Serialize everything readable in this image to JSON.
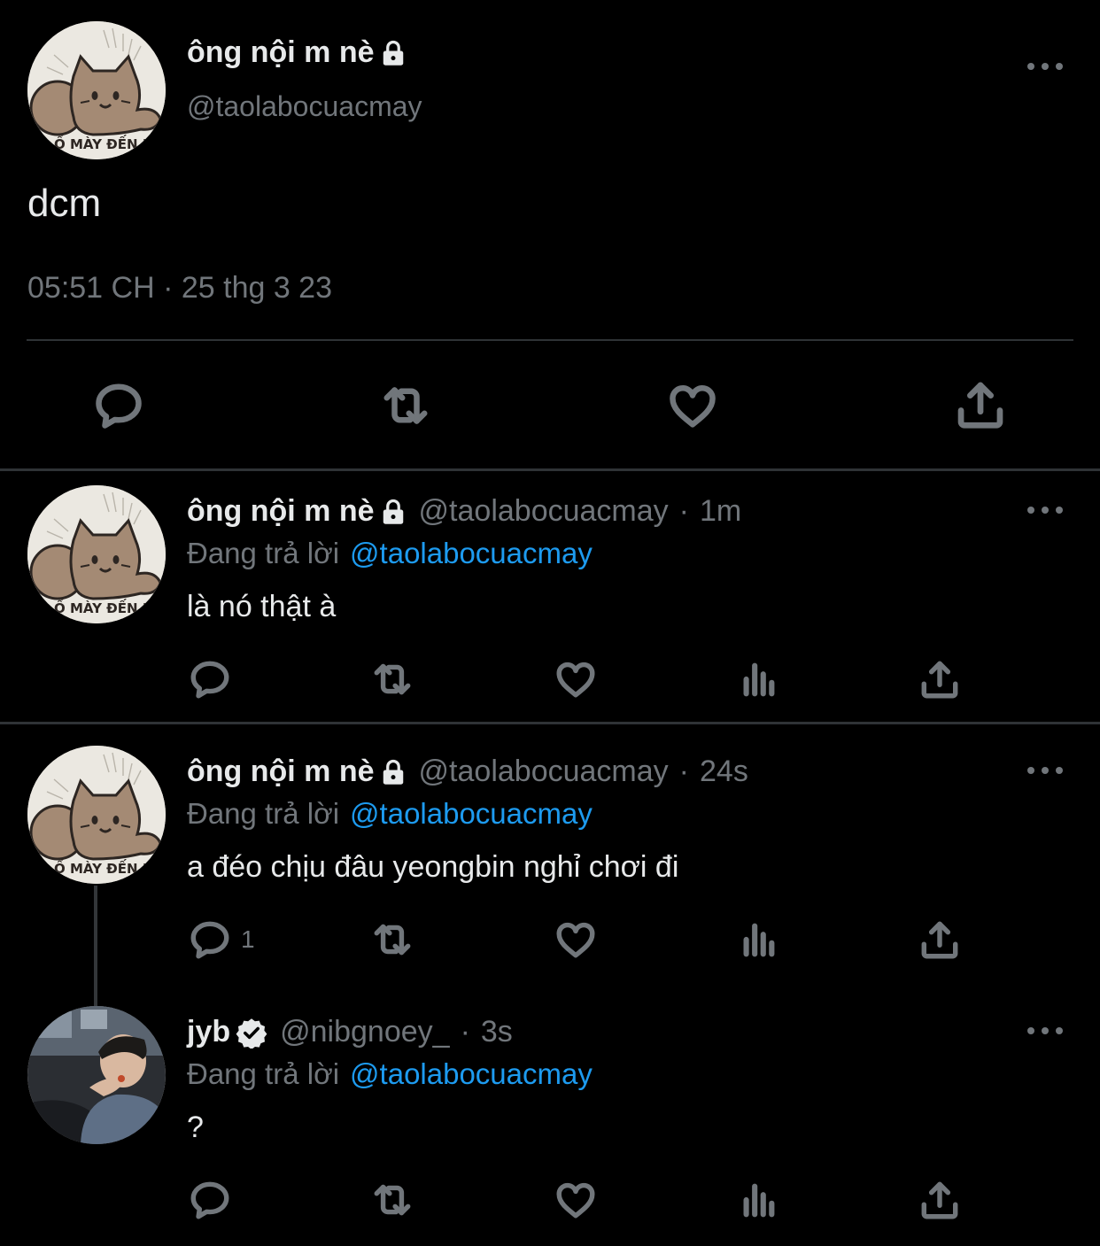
{
  "main_tweet": {
    "name": "ông nội m nè",
    "handle": "@taolabocuacmay",
    "text": "dcm",
    "timestamp": "05:51 CH · 25 thg 3 23",
    "avatar_caption": "Ố MÀY ĐẾN ĐÂ"
  },
  "replies": [
    {
      "name": "ông nội m nè",
      "handle": "@taolabocuacmay",
      "sep": "·",
      "time": "1m",
      "replying_label": "Đang trả lời",
      "replying_to": "@taolabocuacmay",
      "text": "là nó thật à",
      "avatar_caption": "Ố MÀY ĐẾN ĐÂ"
    },
    {
      "name": "ông nội m nè",
      "handle": "@taolabocuacmay",
      "sep": "·",
      "time": "24s",
      "replying_label": "Đang trả lời",
      "replying_to": "@taolabocuacmay",
      "text": "a đéo chịu đâu yeongbin nghỉ chơi đi",
      "reply_count": "1",
      "avatar_caption": "Ố MÀY ĐẾN ĐÂ"
    },
    {
      "name": "jyb",
      "handle": "@nibgnoey_",
      "sep": "·",
      "time": "3s",
      "replying_label": "Đang trả lời",
      "replying_to": "@taolabocuacmay",
      "text": "?"
    }
  ],
  "colors": {
    "background": "#000000",
    "text_primary": "#e7e9ea",
    "text_secondary": "#71767b",
    "accent_link": "#1d9bf0",
    "divider": "#2f3336"
  },
  "icons": [
    "lock-icon",
    "verified-badge-icon",
    "more-options-icon",
    "reply-icon",
    "retweet-icon",
    "like-icon",
    "analytics-icon",
    "share-icon"
  ]
}
